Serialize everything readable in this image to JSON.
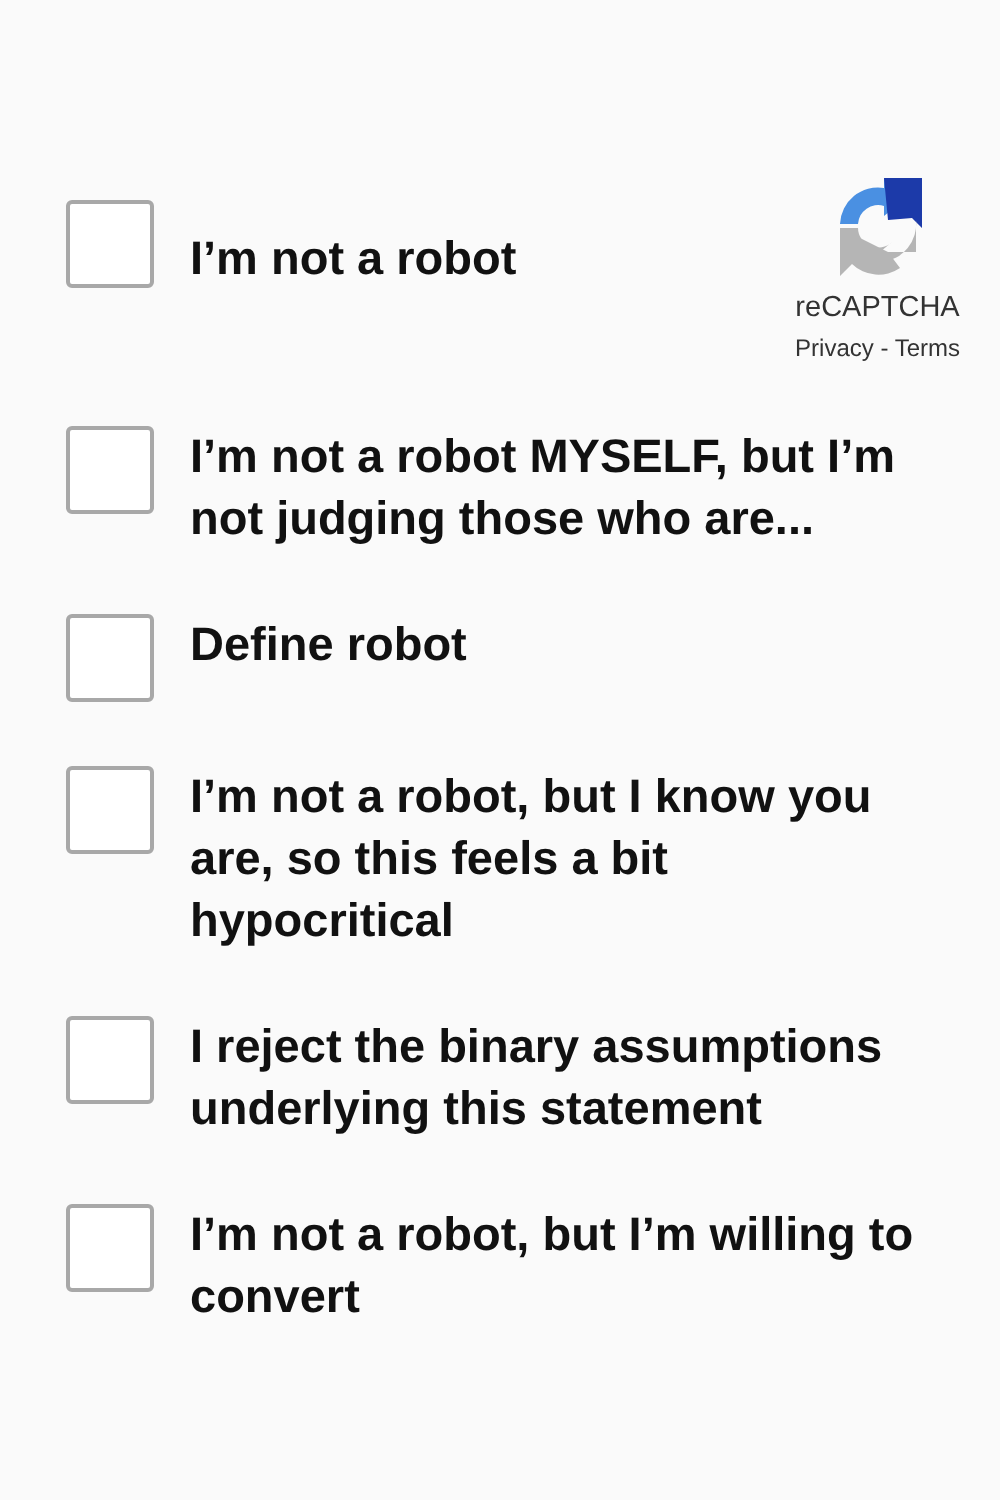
{
  "badge": {
    "brand": "reCAPTCHA",
    "links": "Privacy - Terms"
  },
  "options": [
    {
      "label": "I’m not a robot",
      "checked": false
    },
    {
      "label": "I’m not a robot MYSELF, but I’m not judging those who are...",
      "checked": false
    },
    {
      "label": "Define robot",
      "checked": false
    },
    {
      "label": "I’m not a robot, but I know you are, so this feels a bit hypocritical",
      "checked": false
    },
    {
      "label": "I reject the binary assumptions underlying this statement",
      "checked": false
    },
    {
      "label": "I’m not a robot, but I’m willing to convert",
      "checked": false
    }
  ]
}
